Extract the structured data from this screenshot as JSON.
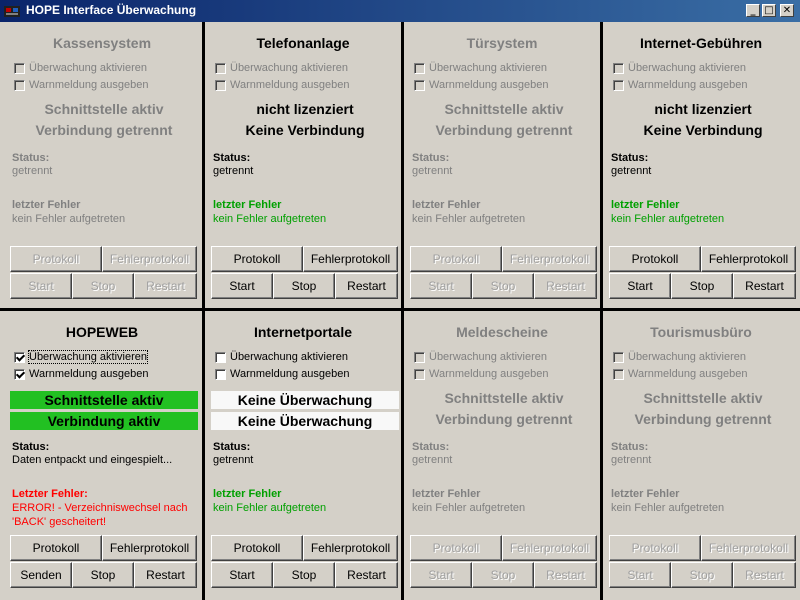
{
  "window": {
    "title": "HOPE Interface Überwachung",
    "minimize_glyph": "_",
    "maximize_glyph": "□",
    "close_glyph": "✕",
    "title_color": "#0a246a"
  },
  "labels": {
    "watch": "Überwachung aktivieren",
    "warn": "Warnmeldung ausgeben",
    "status": "Status:",
    "protokoll": "Protokoll",
    "fehlerprotokoll": "Fehlerprotokoll",
    "stop": "Stop",
    "restart": "Restart"
  },
  "colors": {
    "active_green": "#22c022",
    "ok_text": "#00a000",
    "error_text": "#ff0000",
    "disabled": "#808080"
  },
  "panels": [
    {
      "title": "Kassensystem",
      "enabled": false,
      "watch_checked": false,
      "warn_checked": false,
      "banner1": "Schnittstelle aktiv",
      "banner2": "Verbindung getrennt",
      "banner_style": "plain",
      "status_value": "getrennt",
      "error_title": "letzter Fehler",
      "error_text": "kein Fehler aufgetreten",
      "error_color": "grey",
      "start_label": "Start"
    },
    {
      "title": "Telefonanlage",
      "enabled": true,
      "watch_checked": false,
      "warn_checked": false,
      "banner1": "nicht lizenziert",
      "banner2": "Keine Verbindung",
      "banner_style": "plain",
      "status_value": "getrennt",
      "error_title": "letzter Fehler",
      "error_text": "kein Fehler aufgetreten",
      "error_color": "green",
      "start_label": "Start",
      "controls_disabled": true
    },
    {
      "title": "Türsystem",
      "enabled": false,
      "watch_checked": false,
      "warn_checked": false,
      "banner1": "Schnittstelle aktiv",
      "banner2": "Verbindung getrennt",
      "banner_style": "plain",
      "status_value": "getrennt",
      "error_title": "letzter Fehler",
      "error_text": "kein Fehler aufgetreten",
      "error_color": "grey",
      "start_label": "Start"
    },
    {
      "title": "Internet-Gebühren",
      "enabled": true,
      "watch_checked": false,
      "warn_checked": false,
      "banner1": "nicht lizenziert",
      "banner2": "Keine Verbindung",
      "banner_style": "plain",
      "status_value": "getrennt",
      "error_title": "letzter Fehler",
      "error_text": "kein Fehler aufgetreten",
      "error_color": "green",
      "start_label": "Start",
      "controls_disabled": true
    },
    {
      "title": "HOPEWEB",
      "enabled": true,
      "watch_checked": true,
      "warn_checked": true,
      "banner1": "Schnittstelle aktiv",
      "banner2": "Verbindung aktiv",
      "banner_style": "green",
      "status_value": "Daten entpackt und eingespielt...",
      "error_title": "Letzter Fehler:",
      "error_text": "ERROR! - Verzeichniswechsel nach 'BACK' gescheitert!",
      "error_color": "red",
      "start_label": "Senden"
    },
    {
      "title": "Internetportale",
      "enabled": true,
      "watch_checked": false,
      "warn_checked": false,
      "banner1": "Keine Überwachung",
      "banner2": "Keine Überwachung",
      "banner_style": "white",
      "status_value": "getrennt",
      "error_title": "letzter Fehler",
      "error_text": "kein Fehler aufgetreten",
      "error_color": "green",
      "start_label": "Start"
    },
    {
      "title": "Meldescheine",
      "enabled": false,
      "watch_checked": false,
      "warn_checked": false,
      "banner1": "Schnittstelle aktiv",
      "banner2": "Verbindung getrennt",
      "banner_style": "plain",
      "status_value": "getrennt",
      "error_title": "letzter Fehler",
      "error_text": "kein Fehler aufgetreten",
      "error_color": "grey",
      "start_label": "Start"
    },
    {
      "title": "Tourismusbüro",
      "enabled": false,
      "watch_checked": false,
      "warn_checked": false,
      "banner1": "Schnittstelle aktiv",
      "banner2": "Verbindung getrennt",
      "banner_style": "plain",
      "status_value": "getrennt",
      "error_title": "letzter Fehler",
      "error_text": "kein Fehler aufgetreten",
      "error_color": "grey",
      "start_label": "Start"
    }
  ]
}
